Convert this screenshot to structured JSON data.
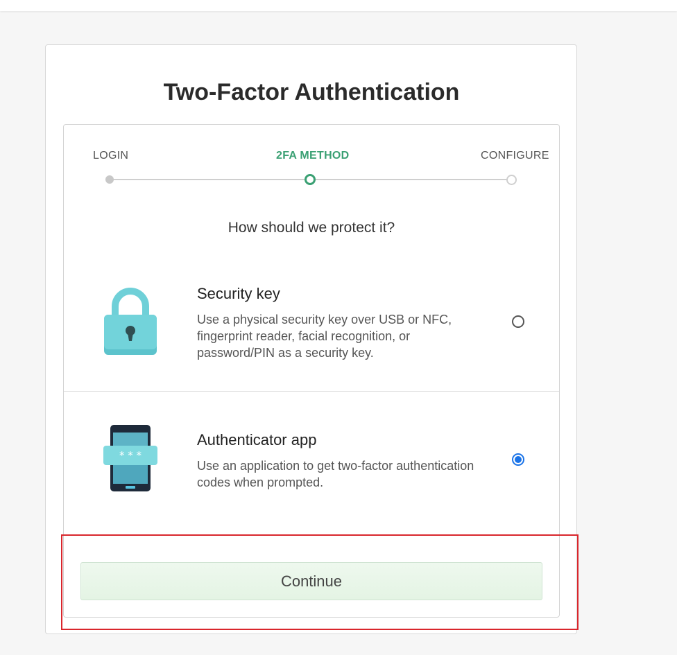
{
  "page": {
    "title": "Two-Factor Authentication"
  },
  "stepper": {
    "steps": [
      {
        "label": "LOGIN",
        "state": "done"
      },
      {
        "label": "2FA METHOD",
        "state": "current"
      },
      {
        "label": "CONFIGURE",
        "state": "todo"
      }
    ],
    "active_color": "#3aa073"
  },
  "question": "How should we protect it?",
  "options": [
    {
      "title": "Security key",
      "description": "Use a physical security key over USB or NFC, fingerprint reader, facial recognition, or password/PIN as a security key.",
      "icon": "padlock-icon",
      "selected": false
    },
    {
      "title": "Authenticator app",
      "description": "Use an application to get two-factor authentication codes when prompted.",
      "icon": "phone-icon",
      "selected": true
    }
  ],
  "continue_label": "Continue",
  "colors": {
    "radio_selected": "#1a73e8",
    "highlight_box": "#d9262c",
    "button_bg": "#e8f5e9"
  }
}
